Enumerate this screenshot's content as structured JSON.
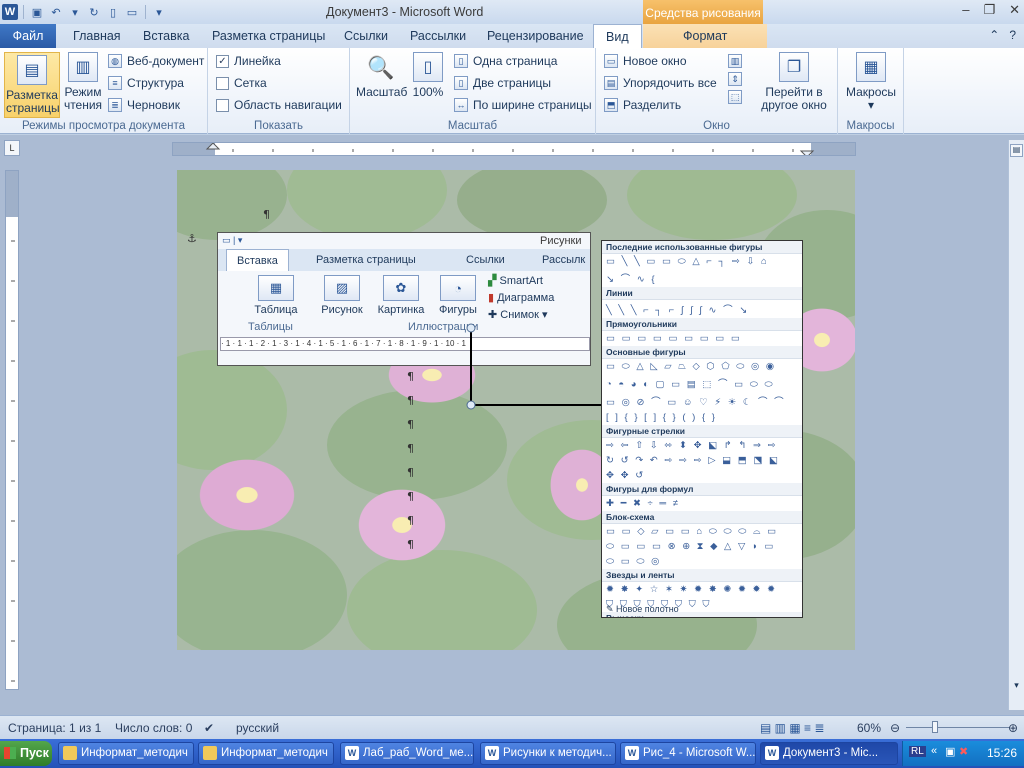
{
  "window": {
    "title": "Документ3 - Microsoft Word",
    "drawing_tools": "Средства рисования",
    "app_icon": "W"
  },
  "tabs": {
    "file": "Файл",
    "items": [
      "Главная",
      "Вставка",
      "Разметка страницы",
      "Ссылки",
      "Рассылки",
      "Рецензирование",
      "Вид"
    ],
    "format": "Формат"
  },
  "ribbon": {
    "views": {
      "print_layout": "Разметка страницы",
      "reading": "Режим чтения",
      "web": "Веб-документ",
      "outline": "Структура",
      "draft": "Черновик",
      "label": "Режимы просмотра документа"
    },
    "show": {
      "ruler": "Линейка",
      "grid": "Сетка",
      "nav": "Область навигации",
      "label": "Показать"
    },
    "zoom": {
      "zoom": "Масштаб",
      "hundred": "100%",
      "one_page": "Одна страница",
      "two_pages": "Две страницы",
      "page_width": "По ширине страницы",
      "label": "Масштаб"
    },
    "window": {
      "new": "Новое окно",
      "arrange": "Упорядочить все",
      "split": "Разделить",
      "switch_line1": "Перейти в",
      "switch_line2": "другое окно",
      "label": "Окно"
    },
    "macros": {
      "macros": "Макросы",
      "label": "Макросы"
    }
  },
  "screenshot": {
    "title_partial": "Рисунки",
    "tabs": [
      "Вставка",
      "Разметка страницы",
      "Ссылки",
      "Рассылк"
    ],
    "buttons": [
      "Таблица",
      "Рисунок",
      "Картинка",
      "Фигуры"
    ],
    "small": [
      "SmartArt",
      "Диаграмма",
      "Снимок"
    ],
    "groups": [
      "Таблицы",
      "Иллюстрации"
    ],
    "ruler": "· 1 · 1 · 1 · 2 · 1 · 3 · 1 · 4 · 1 · 5 · 1 · 6 · 1 · 7 · 1 · 8 · 1 · 9 · 1 · 10 · 1"
  },
  "shapes_panel": {
    "sections": [
      {
        "title": "Последние использованные фигуры",
        "rows": [
          "▭ ╲ ╲ ▭ ▭ ⬭ △ ⌐ ┐ ⇨ ⇩ ⌂",
          "↘ ⌒ ∿ {"
        ]
      },
      {
        "title": "Линии",
        "rows": [
          "╲ ╲ ╲ ⌐ ┐ ⌐ ∫ ∫ ∫ ∿ ⌒ ↘"
        ]
      },
      {
        "title": "Прямоугольники",
        "rows": [
          "▭ ▭ ▭ ▭ ▭ ▭ ▭ ▭ ▭"
        ]
      },
      {
        "title": "Основные фигуры",
        "rows": [
          "▭ ⬭ △ ◺ ▱ ⏢ ◇ ⬡ ⬠ ⬭ ◎ ◉",
          "◔ ◓ ◕ ◐ ▢ ▭ ▤ ⬚ ⌒ ▭ ⬭ ⬭",
          "▭ ◎ ⊘ ⌒ ▭ ☺ ♡ ⚡ ☀ ☾ ⌒ ⌒",
          "[ ] { } [ ] { } ( ) { }"
        ]
      },
      {
        "title": "Фигурные стрелки",
        "rows": [
          "⇨ ⇦ ⇧ ⇩ ⬄ ⬍ ✥ ⬕ ↱ ↰ ⇒ ⇨",
          "↻ ↺ ↷ ↶ ⇨ ⇨ ⇨ ▷ ⬓ ⬒ ⬔ ⬕",
          "✥ ✥ ↺"
        ]
      },
      {
        "title": "Фигуры для формул",
        "rows": [
          "✚ ━ ✖ ÷ ═ ≠"
        ]
      },
      {
        "title": "Блок-схема",
        "rows": [
          "▭ ▭ ◇ ▱ ▭ ▭ ⌂ ⬭ ⬭ ⬭ ⌓ ▭",
          "⬭ ▭ ▭ ▭ ⊗ ⊕ ⧗ ◆ △ ▽ ◗ ▭",
          "⬭ ▭ ⬭ ◎"
        ]
      },
      {
        "title": "Звезды и ленты",
        "rows": [
          "✹ ✸ ✦ ☆ ✶ ✷ ✹ ✸ ✺ ✹ ✹ ✹",
          "⛉ ⛉ ⛉ ⛉ ⛉ ⛉ ⛉ ⛉"
        ]
      },
      {
        "title": "Выноски",
        "rows": [
          "▭ ▭ ⬭ ☁ ⌐ ⌐ ⌐ ⌐ ⌐ ⌐ ⌐ ⌐",
          "⌐ ⌐ ⌐ ⌐"
        ]
      }
    ],
    "footer": "Новое полотно"
  },
  "statusbar": {
    "page": "Страница: 1 из 1",
    "words": "Число слов: 0",
    "lang": "русский",
    "zoom": "60%",
    "zoom_level": 0.6
  },
  "taskbar": {
    "start": "Пуск",
    "items": [
      {
        "label": "Информат_методич",
        "icon": "folder-icon"
      },
      {
        "label": "Информат_методич",
        "icon": "folder-icon"
      },
      {
        "label": "Лаб_раб_Word_ме...",
        "icon": "word-icon"
      },
      {
        "label": "Рисунки к методич...",
        "icon": "word-icon"
      },
      {
        "label": "Рис_4 - Microsoft W...",
        "icon": "word-icon"
      },
      {
        "label": "Документ3 - Mic...",
        "icon": "word-icon"
      }
    ],
    "lang": "RL",
    "time": "15:26"
  },
  "colors": {
    "file_tab": "#2a5aa6",
    "drawing_tools": "#e9a440",
    "taskbar": "#2452b8",
    "start": "#2f7d2a"
  }
}
